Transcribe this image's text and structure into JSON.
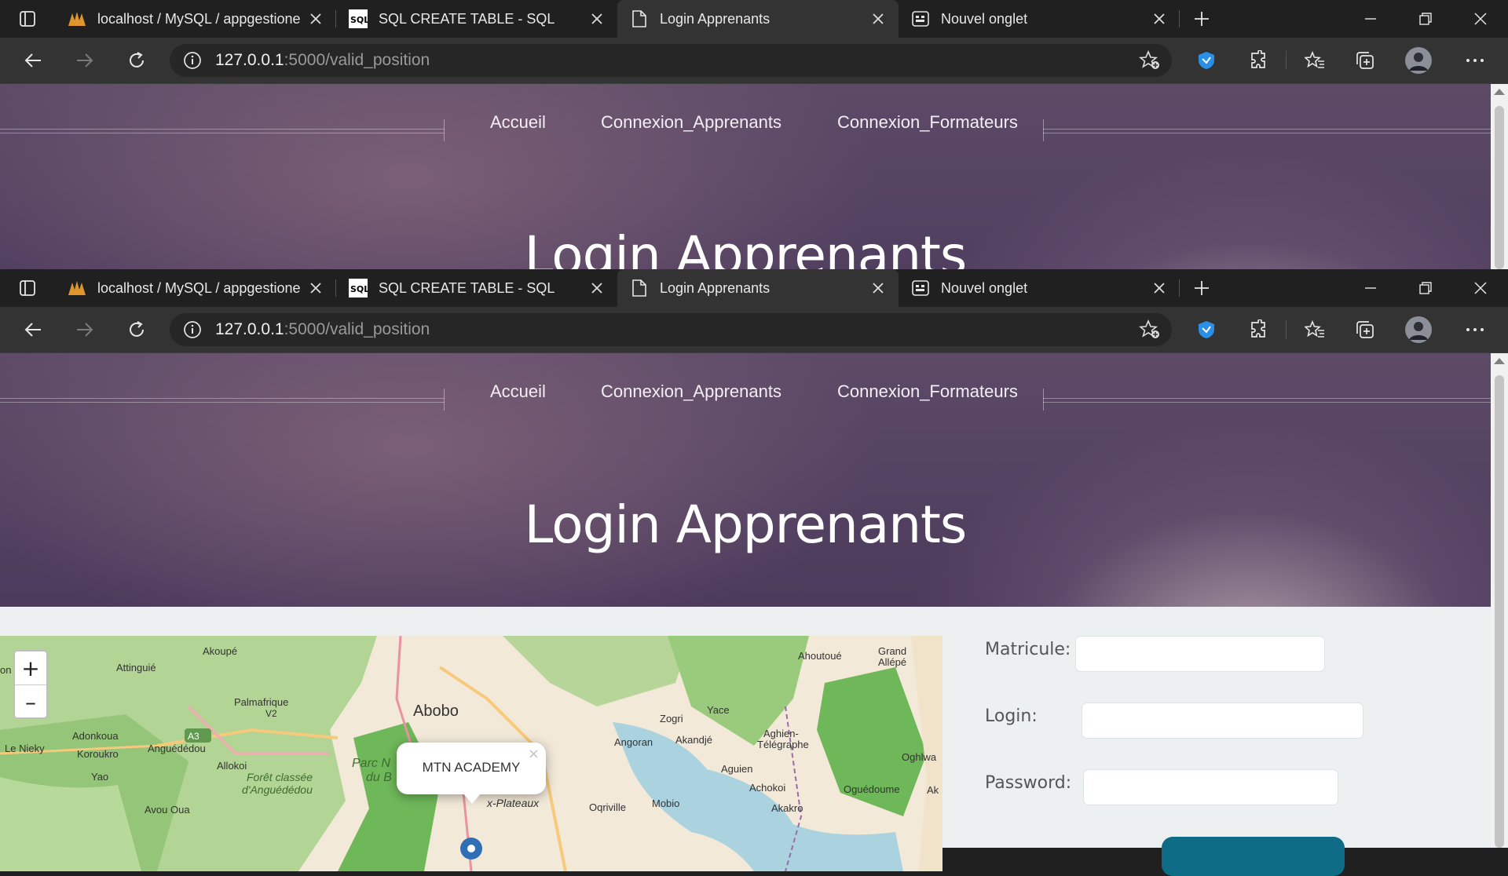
{
  "browser": {
    "tabs": [
      {
        "label": "localhost / MySQL / appgestione",
        "icon": "phpmyadmin-icon"
      },
      {
        "label": "SQL CREATE TABLE - SQL",
        "icon": "sql-icon"
      },
      {
        "label": "Login Apprenants",
        "icon": "document-icon",
        "active": true
      },
      {
        "label": "Nouvel onglet",
        "icon": "newtab-page-icon"
      }
    ],
    "address_host": "127.0.0.1",
    "address_rest": ":5000/valid_position"
  },
  "page": {
    "nav": {
      "items": [
        "Accueil",
        "Connexion_Apprenants",
        "Connexion_Formateurs"
      ]
    },
    "hero_title": "Login Apprenants",
    "form": {
      "matricule_label": "Matricule:",
      "login_label": "Login:",
      "password_label": "Password:"
    },
    "map": {
      "zoom_in": "+",
      "zoom_out": "–",
      "popup_text": "MTN ACADEMY",
      "popup_close": "×",
      "labels": [
        "Akoupé",
        "Attinguié",
        "Palmafrique",
        "V2",
        "A3",
        "Abobo",
        "Adonkoua",
        "Koroukro",
        "Anguédédou",
        "Le Nieky",
        "Yao",
        "Allokoi",
        "Forêt classée",
        "d'Anguédédou",
        "Parc N",
        "du B",
        "Ahoutoué",
        "Grand",
        "Allépé",
        "Zogri",
        "Yace",
        "Angoran",
        "Akandjé",
        "Aghien-",
        "Télégraphe",
        "Oghlwa",
        "Aguien",
        "Achokoi",
        "Oguédoume",
        "Mobio",
        "Oqriville",
        "Akakro",
        "Avou Oua",
        "x-Plateaux",
        "Ak",
        "on"
      ]
    }
  },
  "colors": {
    "accent_button": "#0e6c86",
    "hero": "#4c3a5c",
    "tab_bg": "#202020",
    "toolbar_bg": "#333333"
  }
}
